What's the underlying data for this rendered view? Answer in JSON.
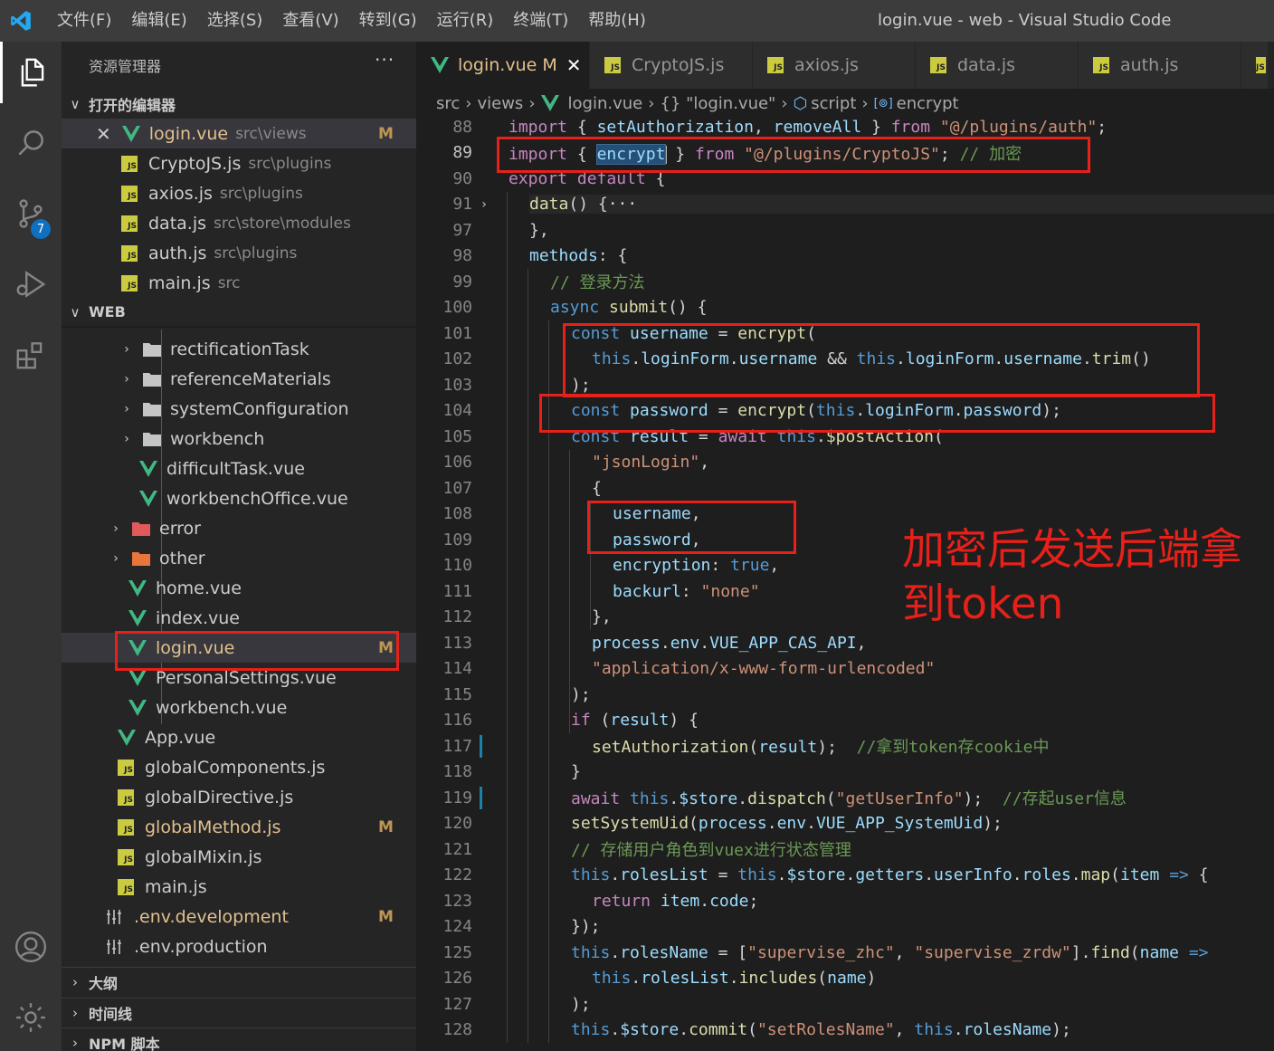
{
  "titlebar": {
    "menu": [
      "文件(F)",
      "编辑(E)",
      "选择(S)",
      "查看(V)",
      "转到(G)",
      "运行(R)",
      "终端(T)",
      "帮助(H)"
    ],
    "title": "login.vue - web - Visual Studio Code"
  },
  "activitybar": {
    "source_control_badge": "7"
  },
  "sidebar": {
    "header": "资源管理器",
    "more": "···",
    "open_editors_label": "打开的编辑器",
    "open_editors": [
      {
        "name": "login.vue",
        "path": "src\\views",
        "badge": "M",
        "icon": "vue",
        "close": "✕"
      },
      {
        "name": "CryptoJS.js",
        "path": "src\\plugins",
        "icon": "js"
      },
      {
        "name": "axios.js",
        "path": "src\\plugins",
        "icon": "js"
      },
      {
        "name": "data.js",
        "path": "src\\store\\modules",
        "icon": "js"
      },
      {
        "name": "auth.js",
        "path": "src\\plugins",
        "icon": "js"
      },
      {
        "name": "main.js",
        "path": "src",
        "icon": "js"
      }
    ],
    "workspace_label": "WEB",
    "tree": [
      {
        "name": "rectificationTask",
        "icon": "folder"
      },
      {
        "name": "referenceMaterials",
        "icon": "folder"
      },
      {
        "name": "systemConfiguration",
        "icon": "folder"
      },
      {
        "name": "workbench",
        "icon": "folder"
      },
      {
        "name": "difficultTask.vue",
        "icon": "vue"
      },
      {
        "name": "workbenchOffice.vue",
        "icon": "vue"
      },
      {
        "name": "error",
        "icon": "folder-red"
      },
      {
        "name": "other",
        "icon": "folder-orange"
      },
      {
        "name": "home.vue",
        "icon": "vue"
      },
      {
        "name": "index.vue",
        "icon": "vue"
      },
      {
        "name": "login.vue",
        "icon": "vue",
        "badge": "M"
      },
      {
        "name": "PersonalSettings.vue",
        "icon": "vue"
      },
      {
        "name": "workbench.vue",
        "icon": "vue"
      },
      {
        "name": "App.vue",
        "icon": "vue"
      },
      {
        "name": "globalComponents.js",
        "icon": "js"
      },
      {
        "name": "globalDirective.js",
        "icon": "js"
      },
      {
        "name": "globalMethod.js",
        "icon": "js",
        "badge": "M"
      },
      {
        "name": "globalMixin.js",
        "icon": "js"
      },
      {
        "name": "main.js",
        "icon": "js"
      },
      {
        "name": ".env.development",
        "icon": "env",
        "badge": "M"
      },
      {
        "name": ".env.production",
        "icon": "env"
      }
    ],
    "outline_label": "大纲",
    "timeline_label": "时间线",
    "npm_label": "NPM 脚本"
  },
  "tabs": [
    {
      "name": "login.vue",
      "badge": "M",
      "icon": "vue",
      "close": "✕"
    },
    {
      "name": "CryptoJS.js",
      "icon": "js"
    },
    {
      "name": "axios.js",
      "icon": "js"
    },
    {
      "name": "data.js",
      "icon": "js"
    },
    {
      "name": "auth.js",
      "icon": "js"
    }
  ],
  "breadcrumb": [
    "src",
    "views",
    "login.vue",
    "{} \"login.vue\"",
    "script",
    "encrypt"
  ],
  "editor": {
    "lines": [
      {
        "n": "88",
        "indent": 0,
        "html": "<span class='c'>import</span> <span class='p'>{ </span><span class='v'>setAuthorization</span><span class='p'>, </span><span class='v'>removeAll</span><span class='p'> } </span><span class='c'>from</span> <span class='s'>\"@/plugins/auth\"</span><span class='p'>;</span>"
      },
      {
        "n": "89",
        "indent": 0,
        "html": "<span class='c'>import</span> <span class='p'>{ </span><span class='v word-hl'>encrypt</span><span class='cursor'></span><span class='p'> } </span><span class='c'>from</span> <span class='s'>\"@/plugins/CryptoJS\"</span><span class='p'>; </span><span class='cm'>// 加密</span>"
      },
      {
        "n": "90",
        "indent": 0,
        "html": "<span class='c'>export</span> <span class='c'>default</span><span class='p'> {</span>"
      },
      {
        "n": "91",
        "indent": 1,
        "fold": "›",
        "hl": true,
        "html": "<span class='f'>data</span><span class='p'>() {</span><span class='p'>···</span>"
      },
      {
        "n": "97",
        "indent": 1,
        "html": "<span class='p'>},</span>"
      },
      {
        "n": "98",
        "indent": 1,
        "html": "<span class='v'>methods</span><span class='p'>: {</span>"
      },
      {
        "n": "99",
        "indent": 2,
        "html": "<span class='cm'>// 登录方法</span>"
      },
      {
        "n": "100",
        "indent": 2,
        "html": "<span class='k'>async</span> <span class='f'>submit</span><span class='p'>() {</span>"
      },
      {
        "n": "101",
        "indent": 3,
        "html": "<span class='k'>const</span> <span class='v'>username</span><span class='p'> = </span><span class='f'>encrypt</span><span class='p'>(</span>"
      },
      {
        "n": "102",
        "indent": 4,
        "html": "<span class='k'>this</span><span class='p'>.</span><span class='v'>loginForm</span><span class='p'>.</span><span class='v'>username</span><span class='p'> &amp;&amp; </span><span class='k'>this</span><span class='p'>.</span><span class='v'>loginForm</span><span class='p'>.</span><span class='v'>username</span><span class='p'>.</span><span class='f'>trim</span><span class='p'>()</span>"
      },
      {
        "n": "103",
        "indent": 3,
        "html": "<span class='p'>);</span>"
      },
      {
        "n": "104",
        "indent": 3,
        "html": "<span class='k'>const</span> <span class='v'>password</span><span class='p'> = </span><span class='f'>encrypt</span><span class='p'>(</span><span class='k'>this</span><span class='p'>.</span><span class='v'>loginForm</span><span class='p'>.</span><span class='v'>password</span><span class='p'>);</span>"
      },
      {
        "n": "105",
        "indent": 3,
        "html": "<span class='k'>const</span> <span class='v'>result</span><span class='p'> = </span><span class='c'>await</span> <span class='k'>this</span><span class='p'>.</span><span class='f'>$postAction</span><span class='p'>(</span>"
      },
      {
        "n": "106",
        "indent": 4,
        "html": "<span class='s'>\"jsonLogin\"</span><span class='p'>,</span>"
      },
      {
        "n": "107",
        "indent": 4,
        "html": "<span class='p'>{</span>"
      },
      {
        "n": "108",
        "indent": 5,
        "html": "<span class='v'>username</span><span class='p'>,</span>"
      },
      {
        "n": "109",
        "indent": 5,
        "html": "<span class='v'>password</span><span class='p'>,</span>"
      },
      {
        "n": "110",
        "indent": 5,
        "html": "<span class='v'>encryption</span><span class='p'>: </span><span class='k'>true</span><span class='p'>,</span>"
      },
      {
        "n": "111",
        "indent": 5,
        "html": "<span class='v'>backurl</span><span class='p'>: </span><span class='s'>\"none\"</span>"
      },
      {
        "n": "112",
        "indent": 4,
        "html": "<span class='p'>},</span>"
      },
      {
        "n": "113",
        "indent": 4,
        "html": "<span class='v'>process</span><span class='p'>.</span><span class='v'>env</span><span class='p'>.</span><span class='v'>VUE_APP_CAS_API</span><span class='p'>,</span>"
      },
      {
        "n": "114",
        "indent": 4,
        "html": "<span class='s'>\"application/x-www-form-urlencoded\"</span>"
      },
      {
        "n": "115",
        "indent": 3,
        "html": "<span class='p'>);</span>"
      },
      {
        "n": "116",
        "indent": 3,
        "html": "<span class='c'>if</span><span class='p'> (</span><span class='v'>result</span><span class='p'>) {</span>"
      },
      {
        "n": "117",
        "indent": 4,
        "mod": true,
        "html": "<span class='f'>setAuthorization</span><span class='p'>(</span><span class='v'>result</span><span class='p'>);  </span><span class='cm'>//拿到token存cookie中</span>"
      },
      {
        "n": "118",
        "indent": 3,
        "html": "<span class='p'>}</span>"
      },
      {
        "n": "119",
        "indent": 3,
        "mod": true,
        "html": "<span class='c'>await</span> <span class='k'>this</span><span class='p'>.</span><span class='v'>$store</span><span class='p'>.</span><span class='f'>dispatch</span><span class='p'>(</span><span class='s'>\"getUserInfo\"</span><span class='p'>);  </span><span class='cm'>//存起user信息</span>"
      },
      {
        "n": "120",
        "indent": 3,
        "html": "<span class='f'>setSystemUid</span><span class='p'>(</span><span class='v'>process</span><span class='p'>.</span><span class='v'>env</span><span class='p'>.</span><span class='v'>VUE_APP_SystemUid</span><span class='p'>);</span>"
      },
      {
        "n": "121",
        "indent": 3,
        "html": "<span class='cm'>// 存储用户角色到vuex进行状态管理</span>"
      },
      {
        "n": "122",
        "indent": 3,
        "html": "<span class='k'>this</span><span class='p'>.</span><span class='v'>rolesList</span><span class='p'> = </span><span class='k'>this</span><span class='p'>.</span><span class='v'>$store</span><span class='p'>.</span><span class='v'>getters</span><span class='p'>.</span><span class='v'>userInfo</span><span class='p'>.</span><span class='v'>roles</span><span class='p'>.</span><span class='f'>map</span><span class='p'>(</span><span class='v'>item</span><span class='p'> </span><span class='k'>=&gt;</span><span class='p'> {</span>"
      },
      {
        "n": "123",
        "indent": 4,
        "html": "<span class='c'>return</span> <span class='v'>item</span><span class='p'>.</span><span class='v'>code</span><span class='p'>;</span>"
      },
      {
        "n": "124",
        "indent": 3,
        "html": "<span class='p'>});</span>"
      },
      {
        "n": "125",
        "indent": 3,
        "html": "<span class='k'>this</span><span class='p'>.</span><span class='v'>rolesName</span><span class='p'> = [</span><span class='s'>\"supervise_zhc\"</span><span class='p'>, </span><span class='s'>\"supervise_zrdw\"</span><span class='p'>].</span><span class='f'>find</span><span class='p'>(</span><span class='v'>name</span><span class='p'> </span><span class='k'>=&gt;</span>"
      },
      {
        "n": "126",
        "indent": 4,
        "html": "<span class='k'>this</span><span class='p'>.</span><span class='v'>rolesList</span><span class='p'>.</span><span class='f'>includes</span><span class='p'>(</span><span class='v'>name</span><span class='p'>)</span>"
      },
      {
        "n": "127",
        "indent": 3,
        "html": "<span class='p'>);</span>"
      },
      {
        "n": "128",
        "indent": 3,
        "html": "<span class='k'>this</span><span class='p'>.</span><span class='v'>$store</span><span class='p'>.</span><span class='f'>commit</span><span class='p'>(</span><span class='s'>\"setRolesName\"</span><span class='p'>, </span><span class='k'>this</span><span class='p'>.</span><span class='v'>rolesName</span><span class='p'>);</span>"
      }
    ],
    "current_line": "89"
  },
  "annotation": {
    "text": "加密后发送后端拿到token",
    "color": "#e8201a"
  },
  "colors": {
    "accent": "#0e70c0",
    "modified": "#e2c08d",
    "vue_green": "#41b883",
    "js_yellow": "#cbcb41"
  }
}
